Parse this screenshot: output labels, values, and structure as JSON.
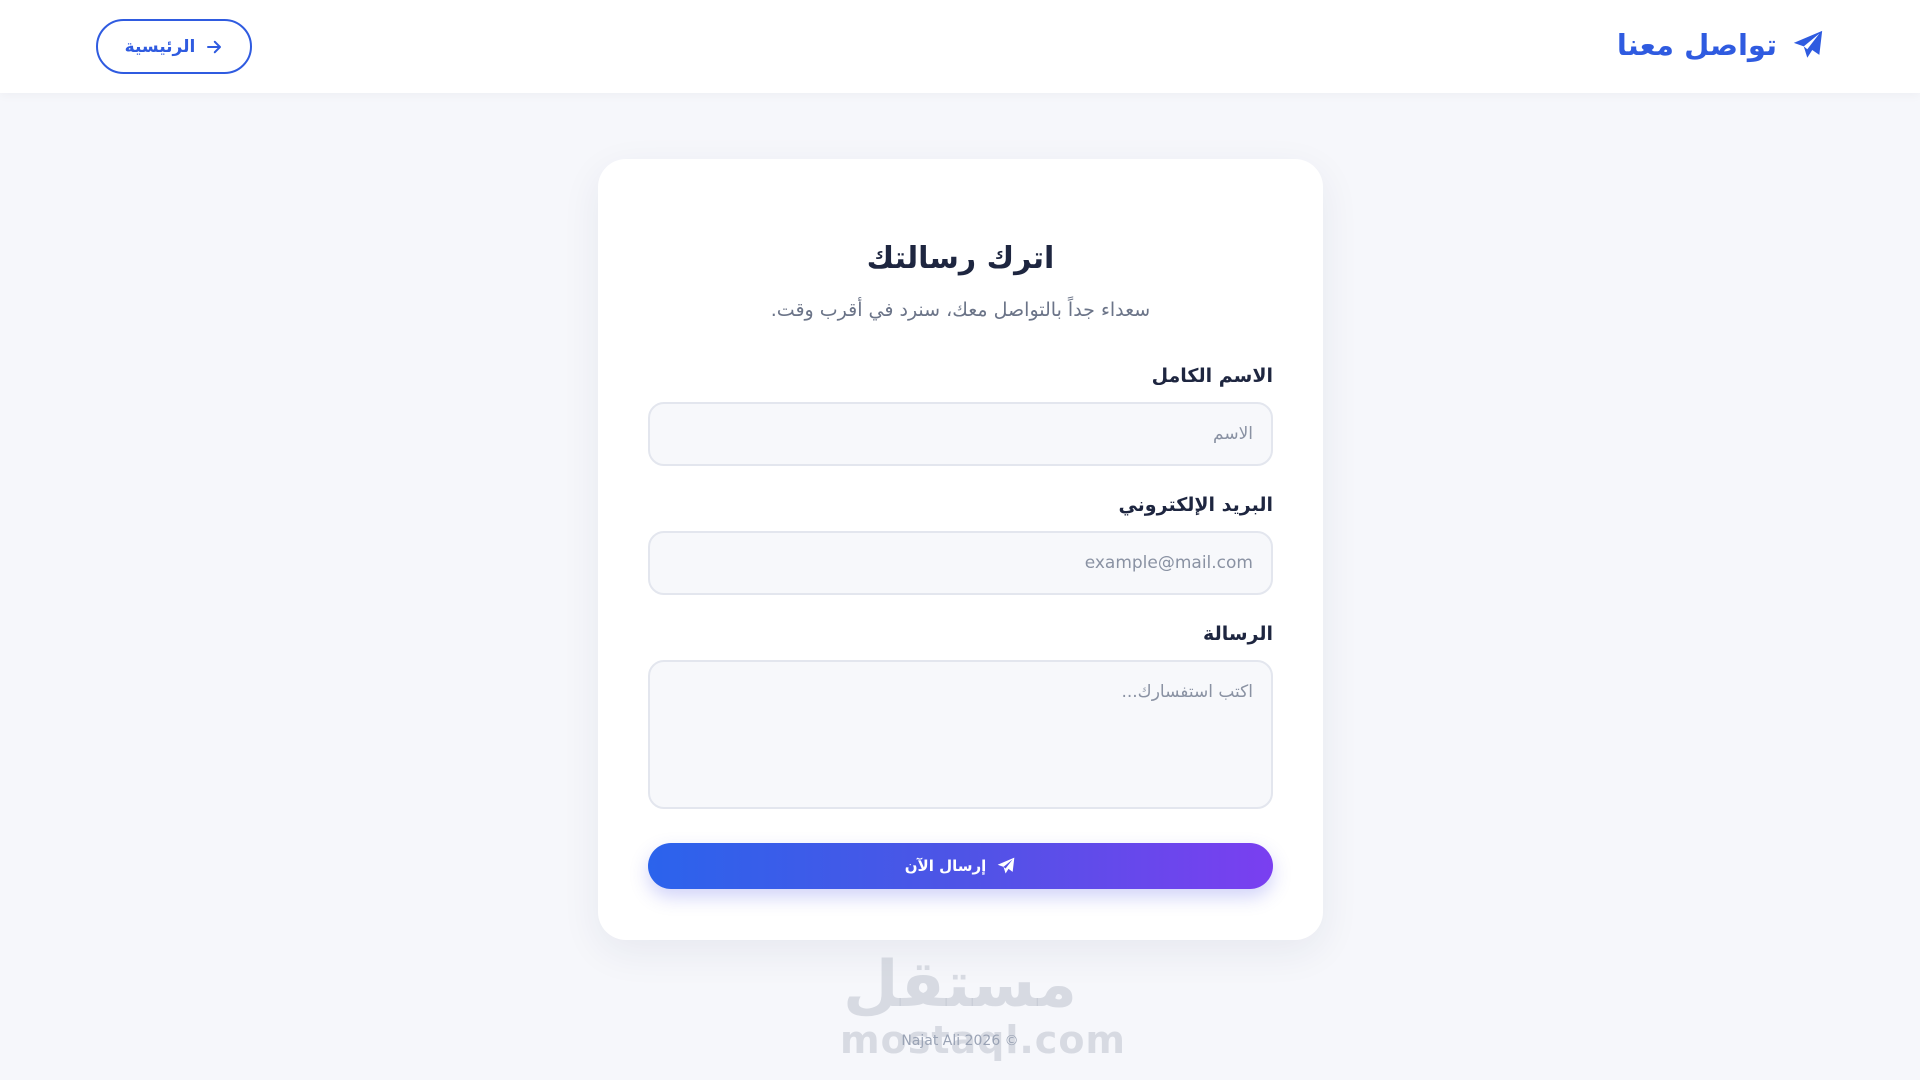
{
  "header": {
    "brand_title": "تواصل معنا",
    "home_label": "الرئيسية"
  },
  "form": {
    "title": "اترك رسالتك",
    "subtitle": "سعداء جداً بالتواصل معك، سنرد في أقرب وقت.",
    "name_label": "الاسم الكامل",
    "name_placeholder": "الاسم",
    "email_label": "البريد الإلكتروني",
    "email_placeholder": "example@mail.com",
    "message_label": "الرسالة",
    "message_placeholder": "اكتب استفسارك...",
    "submit_label": "إرسال الآن"
  },
  "watermark": {
    "arabic": "مستقل",
    "latin": "mostaql.com"
  },
  "footer": {
    "text": "© 2026 Najat Ali"
  },
  "colors": {
    "accent": "#2f5be0",
    "gradient_start": "#2b63ec",
    "gradient_end": "#7a3ff0",
    "background": "#f6f7fb"
  },
  "icons": {
    "brand": "paper-plane-icon",
    "home": "arrow-right-icon",
    "submit": "paper-plane-icon"
  }
}
